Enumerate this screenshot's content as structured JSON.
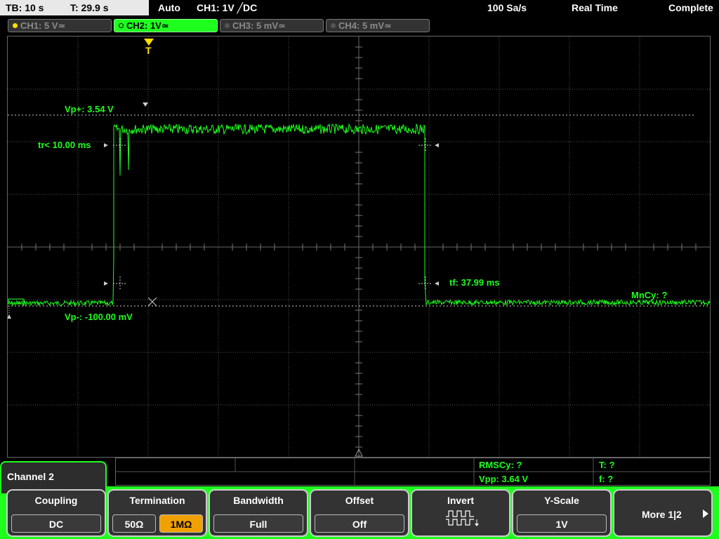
{
  "status": {
    "tb": "TB: 10 s",
    "t": "T: 29.9 s",
    "mode": "Auto",
    "trigger": "CH1: 1V ╱DC",
    "rate": "100 Sa/s",
    "acq": "Real Time",
    "state": "Complete"
  },
  "channels": [
    {
      "label": "CH1: 5 V≃",
      "dot": "#ffe000",
      "active": false
    },
    {
      "label": "CH2: 1V≃",
      "dot": "#000000",
      "active": true
    },
    {
      "label": "CH3: 5 mV≃",
      "dot": "#555555",
      "active": false
    },
    {
      "label": "CH4: 5 mV≃",
      "dot": "#555555",
      "active": false
    }
  ],
  "trigger_marker": "T",
  "measurements": {
    "vp_plus": "Vp+: 3.54 V",
    "tr": "tr< 10.00 ms",
    "tf": "tf: 37.99 ms",
    "vp_minus": "Vp-: -100.00 mV",
    "mncy": "MnCy: ?"
  },
  "meas_table": {
    "rmscy": "RMSCy: ?",
    "t": "T: ?",
    "vpp": "Vpp: 3.64 V",
    "f": "f: ?"
  },
  "channel_label": "Channel 2",
  "softkeys": {
    "coupling": {
      "title": "Coupling",
      "value": "DC"
    },
    "termination": {
      "title": "Termination",
      "opt1": "50Ω",
      "opt2": "1MΩ"
    },
    "bandwidth": {
      "title": "Bandwidth",
      "value": "Full"
    },
    "offset": {
      "title": "Offset",
      "value": "Off"
    },
    "invert": {
      "title": "Invert"
    },
    "yscale": {
      "title": "Y-Scale",
      "value": "1V"
    },
    "more": {
      "label": "More 1|2"
    }
  },
  "colors": {
    "trace": "#1eff1e",
    "ch1": "#ffe000",
    "accent": "#f0a000"
  }
}
